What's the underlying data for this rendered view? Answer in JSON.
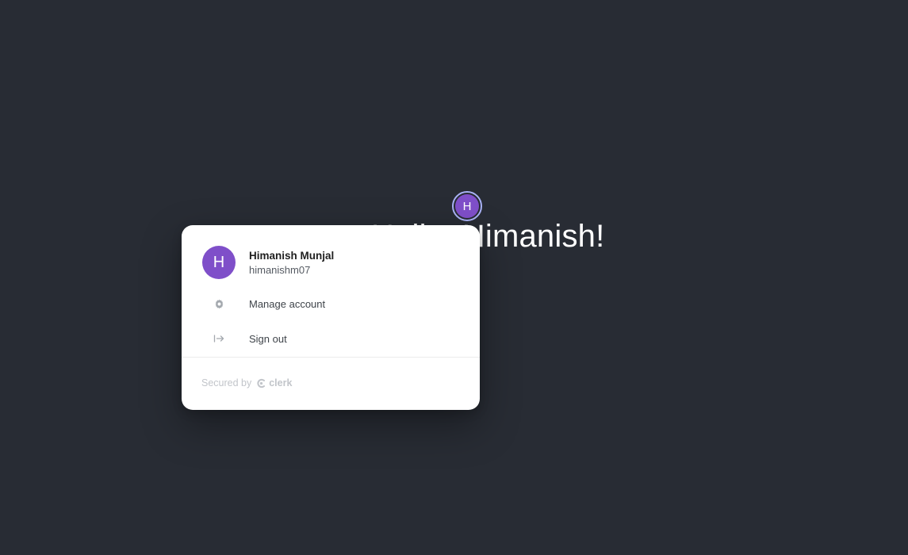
{
  "background": {
    "greeting": "Hello, Himanish!",
    "color": "#282c34"
  },
  "user_button": {
    "initial": "H",
    "ring_color": "#a9b2f5",
    "fill_color": "#7f4fc9"
  },
  "popover": {
    "profile": {
      "initial": "H",
      "name": "Himanish Munjal",
      "username": "himanishm07"
    },
    "menu": [
      {
        "label": "Manage account",
        "icon": "gear-icon"
      },
      {
        "label": "Sign out",
        "icon": "sign-out-icon"
      }
    ],
    "footer": {
      "secured_by": "Secured by",
      "brand": "clerk",
      "brand_icon": "clerk-logo-icon"
    }
  }
}
